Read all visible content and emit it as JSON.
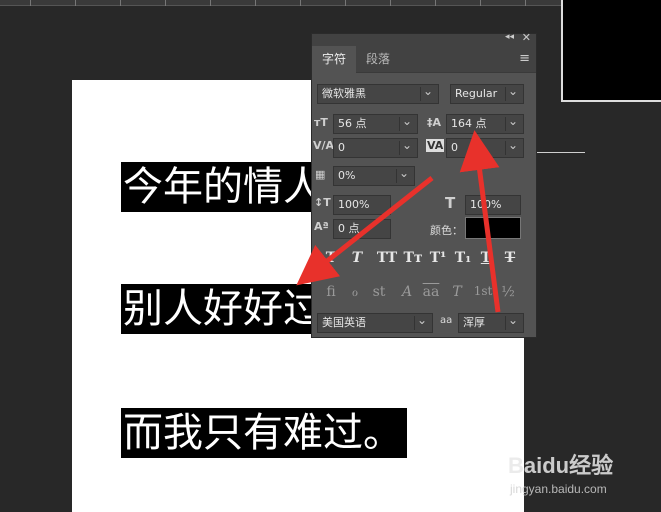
{
  "document": {
    "lines": [
      "今年的情人",
      "别人好好过",
      "而我只有难过。"
    ]
  },
  "panel": {
    "tabs": [
      {
        "label": "字符",
        "active": true
      },
      {
        "label": "段落",
        "active": false
      }
    ],
    "font_family": "微软雅黑",
    "font_style": "Regular",
    "font_size": "56 点",
    "leading": "164 点",
    "kerning": "0",
    "tracking": "0",
    "tsume": "0%",
    "vertical_scale": "100%",
    "horizontal_scale": "100%",
    "baseline_shift": "0 点",
    "color_label": "颜色：",
    "color_value": "#000000",
    "language": "美国英语",
    "antialias_label": "aa",
    "antialias": "浑厚",
    "style_buttons": [
      "T",
      "T",
      "TT",
      "Tт",
      "T¹",
      "T₁",
      "T",
      "T"
    ],
    "opentype_buttons": [
      "fi",
      "ℴ",
      "st",
      "A",
      "aa",
      "T",
      "1st",
      "½"
    ]
  },
  "watermark": {
    "brand": "Baidu经验",
    "url": "jingyan.baidu.com"
  }
}
